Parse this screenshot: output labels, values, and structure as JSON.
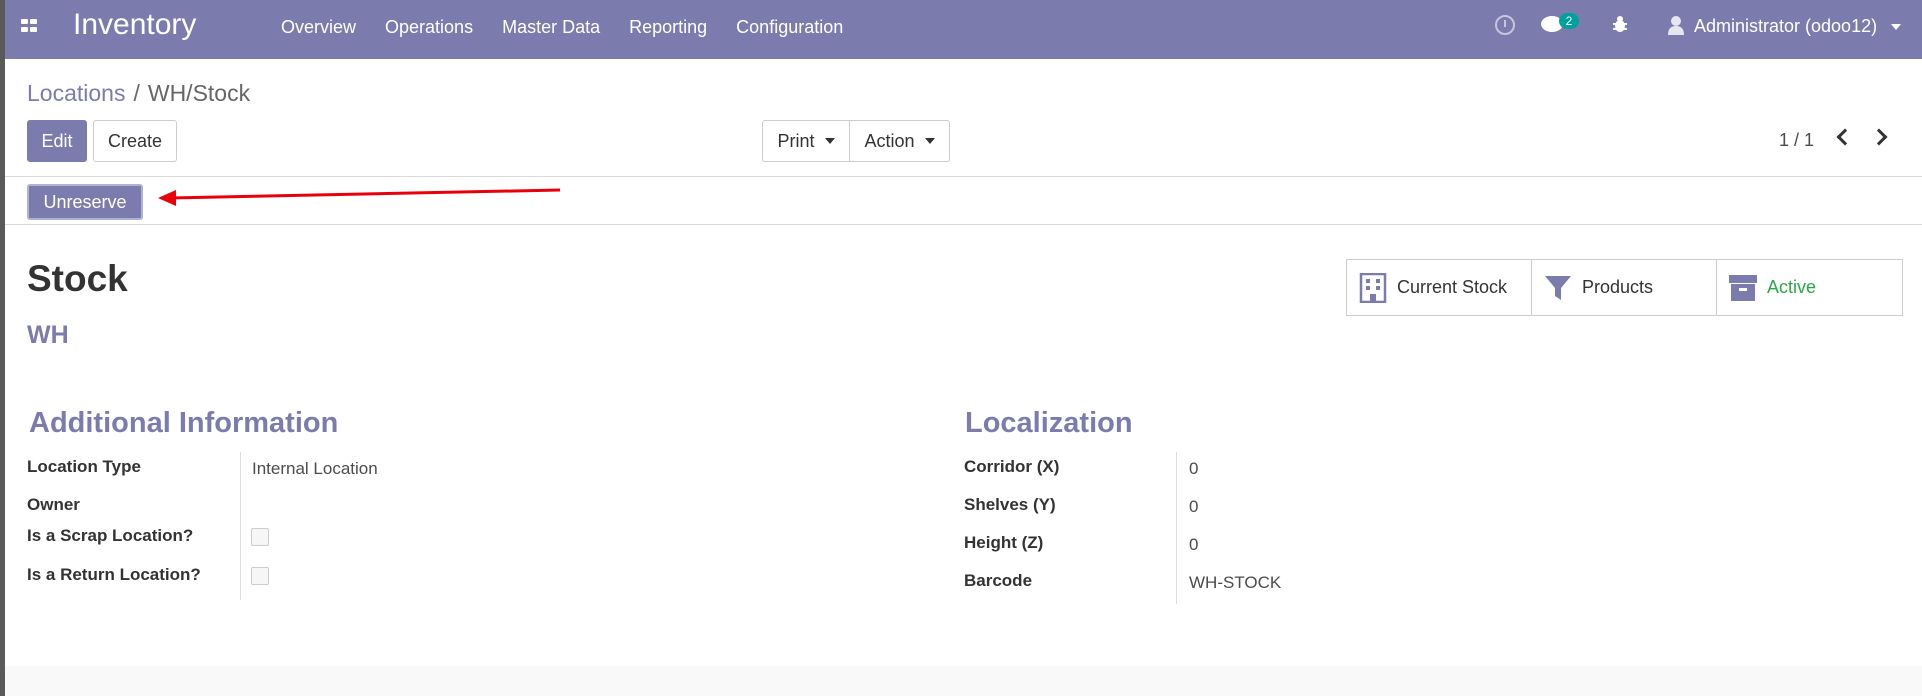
{
  "navbar": {
    "brand": "Inventory",
    "menu": [
      "Overview",
      "Operations",
      "Master Data",
      "Reporting",
      "Configuration"
    ],
    "chat_badge": "2",
    "user": "Administrator (odoo12)"
  },
  "breadcrumb": {
    "parent": "Locations",
    "separator": "/",
    "current": "WH/Stock"
  },
  "buttons": {
    "edit": "Edit",
    "create": "Create",
    "print": "Print",
    "action": "Action",
    "unreserve": "Unreserve"
  },
  "pager": "1 / 1",
  "record": {
    "name": "Stock",
    "parent": "WH"
  },
  "smart_buttons": {
    "current_stock": "Current Stock",
    "products": "Products",
    "active": "Active"
  },
  "additional_info": {
    "title": "Additional Information",
    "location_type_label": "Location Type",
    "location_type_value": "Internal Location",
    "owner_label": "Owner",
    "scrap_label": "Is a Scrap Location?",
    "return_label": "Is a Return Location?"
  },
  "localization": {
    "title": "Localization",
    "corridor_label": "Corridor (X)",
    "corridor_value": "0",
    "shelves_label": "Shelves (Y)",
    "shelves_value": "0",
    "height_label": "Height (Z)",
    "height_value": "0",
    "barcode_label": "Barcode",
    "barcode_value": "WH-STOCK"
  },
  "colors": {
    "brand": "#7c7bad",
    "active": "#28a745",
    "arrow": "#e8000b"
  }
}
